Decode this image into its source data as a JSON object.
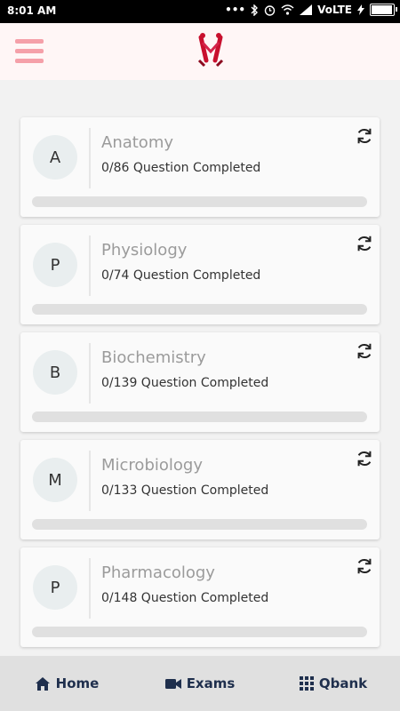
{
  "status_bar": {
    "time": "8:01 AM",
    "network": "VoLTE",
    "battery_level": 0.95
  },
  "header": {
    "menu_icon": "hamburger-menu-icon",
    "logo_icon": "app-logo-m-icon",
    "accent_color": "#f5a0a9"
  },
  "subjects": [
    {
      "initial": "A",
      "name": "Anatomy",
      "progress_text": "0/86 Question Completed",
      "progress": 0
    },
    {
      "initial": "P",
      "name": "Physiology",
      "progress_text": "0/74 Question Completed",
      "progress": 0
    },
    {
      "initial": "B",
      "name": "Biochemistry",
      "progress_text": "0/139 Question Completed",
      "progress": 0
    },
    {
      "initial": "M",
      "name": "Microbiology",
      "progress_text": "0/133 Question Completed",
      "progress": 0
    },
    {
      "initial": "P",
      "name": "Pharmacology",
      "progress_text": "0/148 Question Completed",
      "progress": 0
    }
  ],
  "bottom_nav": [
    {
      "label": "Home",
      "icon": "home-icon"
    },
    {
      "label": "Exams",
      "icon": "video-camera-icon"
    },
    {
      "label": "Qbank",
      "icon": "grid-icon"
    }
  ]
}
